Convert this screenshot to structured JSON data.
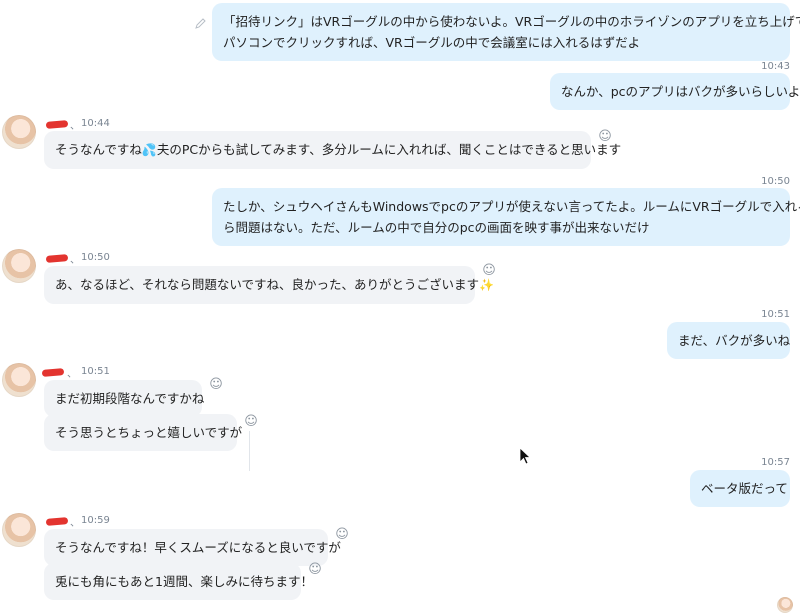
{
  "messages": {
    "m1": {
      "text_line1": "「招待リンク」はVRゴーグルの中から使わないよ。VRゴーグルの中のホライゾンのアプリを立ち上げて、",
      "text_line2": "パソコンでクリックすれば、VRゴーグルの中で会議室には入れるはずだよ"
    },
    "m2": {
      "time": "10:43",
      "text": "なんか、pcのアプリはバクが多いらしいよ"
    },
    "m3": {
      "time": "10:44",
      "sep": "、",
      "text_before": "そうなんですね",
      "emoji": "💦",
      "text_after": "夫のPCからも試してみます、多分ルームに入れれば、聞くことはできると思います"
    },
    "m4": {
      "time": "10:50",
      "text_line1": "たしか、シュウヘイさんもWindowsでpcのアプリが使えない言ってたよ。ルームにVRゴーグルで入れるな",
      "text_line2": "ら問題はない。ただ、ルームの中で自分のpcの画面を映す事が出来ないだけ"
    },
    "m5": {
      "time": "10:50",
      "sep": "、",
      "text_before": "あ、なるほど、それなら問題ないですね、良かった、ありがとうございます",
      "emoji": "✨"
    },
    "m6": {
      "time": "10:51",
      "text": "まだ、バクが多いね"
    },
    "m7": {
      "time": "10:51",
      "sep": "、",
      "text": "まだ初期段階なんですかね"
    },
    "m8": {
      "text": "そう思うとちょっと嬉しいですが"
    },
    "m9": {
      "time": "10:57",
      "text": "ベータ版だって"
    },
    "m10": {
      "time": "10:59",
      "sep": "、",
      "text": "そうなんですね！早くスムーズになると良いですが"
    },
    "m11": {
      "text": "兎にも角にもあと1週間、楽しみに待ちます！"
    }
  },
  "icons": {
    "react": "smiley-face-icon",
    "edit": "pencil-icon",
    "cursor": "mouse-pointer"
  },
  "colors": {
    "outgoing_bubble": "#dff1fd",
    "incoming_bubble": "#f1f3f6",
    "timestamp": "#7a8592",
    "redaction": "#e3342f"
  }
}
